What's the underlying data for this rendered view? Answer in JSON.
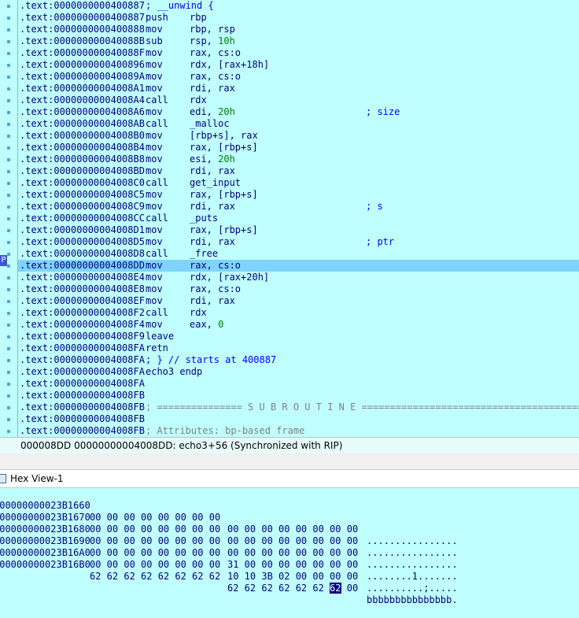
{
  "disasm": {
    "lines": [
      {
        "addr": ".text:0000000000400887",
        "mn": "",
        "op": "",
        "cm": "",
        "full": "; __unwind {"
      },
      {
        "addr": ".text:0000000000400887",
        "mn": "push",
        "op": "rbp",
        "cm": "",
        "full": ""
      },
      {
        "addr": ".text:0000000000400888",
        "mn": "mov",
        "op": "rbp, rsp",
        "cm": "",
        "full": ""
      },
      {
        "addr": ".text:000000000040088B",
        "mn": "sub",
        "op": "rsp, 10h",
        "cm": "",
        "full": ""
      },
      {
        "addr": ".text:000000000040088F",
        "mn": "mov",
        "op": "rax, cs:o",
        "cm": "",
        "full": ""
      },
      {
        "addr": ".text:0000000000400896",
        "mn": "mov",
        "op": "rdx, [rax+18h]",
        "cm": "",
        "full": ""
      },
      {
        "addr": ".text:000000000040089A",
        "mn": "mov",
        "op": "rax, cs:o",
        "cm": "",
        "full": ""
      },
      {
        "addr": ".text:00000000004008A1",
        "mn": "mov",
        "op": "rdi, rax",
        "cm": "",
        "full": ""
      },
      {
        "addr": ".text:00000000004008A4",
        "mn": "call",
        "op": "rdx",
        "cm": "",
        "full": ""
      },
      {
        "addr": ".text:00000000004008A6",
        "mn": "mov",
        "op": "edi, 20h",
        "cm": "; size",
        "full": ""
      },
      {
        "addr": ".text:00000000004008AB",
        "mn": "call",
        "op": "_malloc",
        "cm": "",
        "full": ""
      },
      {
        "addr": ".text:00000000004008B0",
        "mn": "mov",
        "op": "[rbp+s], rax",
        "cm": "",
        "full": ""
      },
      {
        "addr": ".text:00000000004008B4",
        "mn": "mov",
        "op": "rax, [rbp+s]",
        "cm": "",
        "full": ""
      },
      {
        "addr": ".text:00000000004008B8",
        "mn": "mov",
        "op": "esi, 20h",
        "cm": "",
        "full": ""
      },
      {
        "addr": ".text:00000000004008BD",
        "mn": "mov",
        "op": "rdi, rax",
        "cm": "",
        "full": ""
      },
      {
        "addr": ".text:00000000004008C0",
        "mn": "call",
        "op": "get_input",
        "cm": "",
        "full": ""
      },
      {
        "addr": ".text:00000000004008C5",
        "mn": "mov",
        "op": "rax, [rbp+s]",
        "cm": "",
        "full": ""
      },
      {
        "addr": ".text:00000000004008C9",
        "mn": "mov",
        "op": "rdi, rax",
        "cm": "; s",
        "full": ""
      },
      {
        "addr": ".text:00000000004008CC",
        "mn": "call",
        "op": "_puts",
        "cm": "",
        "full": ""
      },
      {
        "addr": ".text:00000000004008D1",
        "mn": "mov",
        "op": "rax, [rbp+s]",
        "cm": "",
        "full": ""
      },
      {
        "addr": ".text:00000000004008D5",
        "mn": "mov",
        "op": "rdi, rax",
        "cm": "; ptr",
        "full": ""
      },
      {
        "addr": ".text:00000000004008D8",
        "mn": "call",
        "op": "_free",
        "cm": "",
        "full": ""
      },
      {
        "addr": ".text:00000000004008DD",
        "mn": "mov",
        "op": "rax, cs:o",
        "cm": "",
        "full": ""
      },
      {
        "addr": ".text:00000000004008E4",
        "mn": "mov",
        "op": "rdx, [rax+20h]",
        "cm": "",
        "full": ""
      },
      {
        "addr": ".text:00000000004008E8",
        "mn": "mov",
        "op": "rax, cs:o",
        "cm": "",
        "full": ""
      },
      {
        "addr": ".text:00000000004008EF",
        "mn": "mov",
        "op": "rdi, rax",
        "cm": "",
        "full": ""
      },
      {
        "addr": ".text:00000000004008F2",
        "mn": "call",
        "op": "rdx",
        "cm": "",
        "full": ""
      },
      {
        "addr": ".text:00000000004008F4",
        "mn": "mov",
        "op": "eax, 0",
        "cm": "",
        "full": ""
      },
      {
        "addr": ".text:00000000004008F9",
        "mn": "leave",
        "op": "",
        "cm": "",
        "full": ""
      },
      {
        "addr": ".text:00000000004008FA",
        "mn": "retn",
        "op": "",
        "cm": "",
        "full": ""
      },
      {
        "addr": ".text:00000000004008FA",
        "mn": "",
        "op": "",
        "cm": "",
        "full": "; } // starts at 400887"
      },
      {
        "addr": ".text:00000000004008FA",
        "mn": "echo3 endp",
        "op": "",
        "cm": "",
        "full": ""
      },
      {
        "addr": ".text:00000000004008FA",
        "mn": "",
        "op": "",
        "cm": "",
        "full": ""
      },
      {
        "addr": ".text:00000000004008FB",
        "mn": "",
        "op": "",
        "cm": "",
        "full": ""
      },
      {
        "addr": ".text:00000000004008FB",
        "mn": "",
        "op": "",
        "cm": "",
        "full": "; =============== S U B R O U T I N E ======================================="
      },
      {
        "addr": ".text:00000000004008FB",
        "mn": "",
        "op": "",
        "cm": "",
        "full": ""
      },
      {
        "addr": ".text:00000000004008FB",
        "mn": "",
        "op": "",
        "cm": "",
        "full": "; Attributes: bp-based frame"
      }
    ]
  },
  "ip_marker": "P",
  "status": {
    "text": "000008DD 00000000004008DD: echo3+56 (Synchronized with RIP)"
  },
  "hexview": {
    "title": "Hex View-1",
    "rows": [
      {
        "addr": "000000000023B1660",
        "b1": "00 00 00 00 00 00 00 00",
        "b2": "00 00 00 00 00 00 00 00",
        "ascii": "................"
      },
      {
        "addr": "000000000023B1670",
        "b1": "00 00 00 00 00 00 00 00",
        "b2": "00 00 00 00 00 00 00 00",
        "ascii": "................"
      },
      {
        "addr": "000000000023B1680",
        "b1": "00 00 00 00 00 00 00 00",
        "b2": "00 00 00 00 00 00 00 00",
        "ascii": "................"
      },
      {
        "addr": "000000000023B1690",
        "b1": "00 00 00 00 00 00 00 00",
        "b2": "31 00 00 00 00 00 00 00",
        "ascii": "........1......."
      },
      {
        "addr": "000000000023B16A0",
        "b1": "00 00 00 00 00 00 00 00",
        "b2": "10 10 3B 02 00 00 00 00",
        "ascii": "..........;....."
      },
      {
        "addr": "000000000023B16B0",
        "b1": "62 62 62 62 62 62 62 62",
        "b2_pre": "62 62 62 62 62 62 ",
        "b2_cursor": "62",
        "b2_post": " 00",
        "ascii": "bbbbbbbbbbbbbbb."
      }
    ]
  },
  "colors": {
    "background": "#c0ffff",
    "highlight": "#7fd3ff",
    "text": "#000080",
    "comment": "#0000ff",
    "number": "#008000"
  }
}
